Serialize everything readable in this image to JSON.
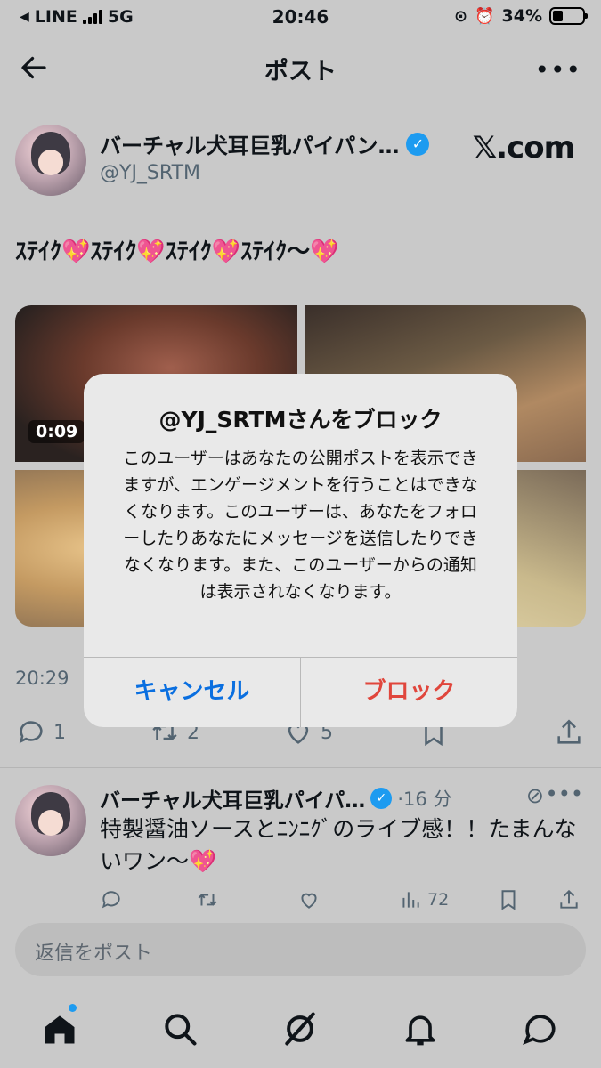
{
  "status_bar": {
    "carrier": "LINE",
    "network": "5G",
    "time": "20:46",
    "battery": "34%"
  },
  "header": {
    "title": "ポスト",
    "back_icon": "arrow-left-icon",
    "more_icon": "more-horizontal-icon"
  },
  "post": {
    "author_name": "バーチャル犬耳巨乳パイパン…",
    "handle": "@YJ_SRTM",
    "source_label": "𝕏.com",
    "text": "ｽﾃｲｸ💖ｽﾃｲｸ💖ｽﾃｲｸ💖ｽﾃｲｸ〜💖",
    "video_duration": "0:09",
    "timestamp": "20:29",
    "replies": "1",
    "reposts": "2",
    "likes": "5"
  },
  "reply": {
    "author_name": "バーチャル犬耳巨乳パイパ…",
    "time": "·16 分",
    "text": "特製醤油ソースとﾆﾝﾆｸﾞのライブ感！！たまんないワン〜💖",
    "views": "72"
  },
  "composer": {
    "placeholder": "返信をポスト"
  },
  "alert": {
    "title": "@YJ_SRTMさんをブロック",
    "message": "このユーザーはあなたの公開ポストを表示できますが、エンゲージメントを行うことはできなくなります。このユーザーは、あなたをフォローしたりあなたにメッセージを送信したりできなくなります。また、このユーザーからの通知は表示されなくなります。",
    "cancel_label": "キャンセル",
    "block_label": "ブロック"
  },
  "colors": {
    "accent": "#1d9bf0",
    "cancel": "#0a6fe0",
    "destructive": "#e0463c",
    "verified_badge": "#1d9bf0"
  },
  "tabbar": [
    "home-icon",
    "search-icon",
    "grok-icon",
    "notifications-icon",
    "messages-icon"
  ]
}
